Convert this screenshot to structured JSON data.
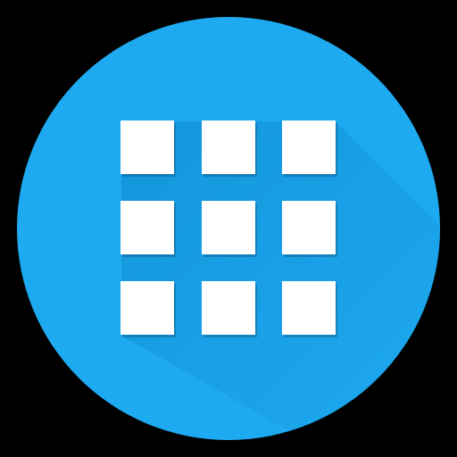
{
  "icon": {
    "name": "app-drawer-grid-icon",
    "background_shape": "circle",
    "colors": {
      "circle": "#1eaaf1",
      "long_shadow": "#0d8fd4",
      "squares": "#ffffff",
      "outer_background": "#000000"
    },
    "grid": {
      "rows": 3,
      "columns": 3
    }
  }
}
